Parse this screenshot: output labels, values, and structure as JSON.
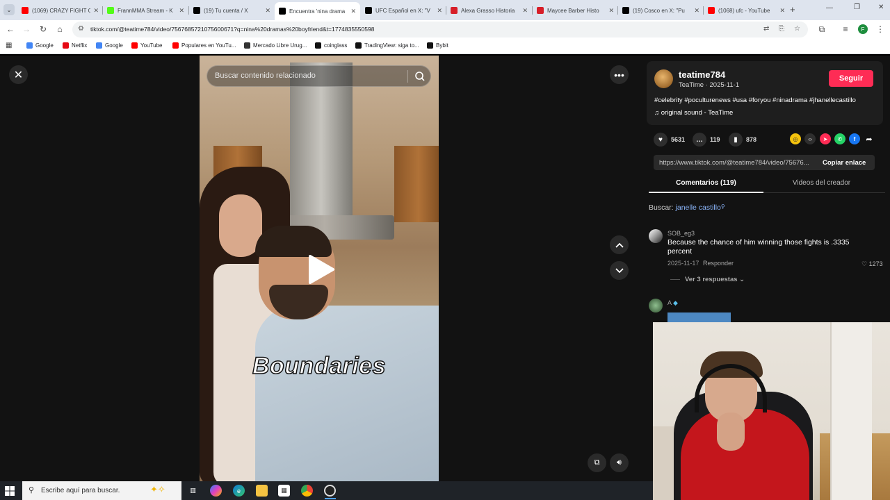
{
  "tabs": [
    {
      "label": "(1069) CRAZY FIGHT C",
      "icon": "youtube-icon",
      "color": "#ff0000"
    },
    {
      "label": "FrannMMA Stream - K",
      "icon": "kick-icon",
      "color": "#53fc18"
    },
    {
      "label": "(19) Tu cuenta / X",
      "icon": "x-icon",
      "color": "#000000"
    },
    {
      "label": "Encuentra 'nina drama",
      "icon": "tiktok-icon",
      "color": "#000000",
      "active": true
    },
    {
      "label": "UFC Español en X: \"V",
      "icon": "x-icon",
      "color": "#000000"
    },
    {
      "label": "Alexa Grasso Historia",
      "icon": "red-icon",
      "color": "#d71e28"
    },
    {
      "label": "Maycee Barber Histo",
      "icon": "red-icon",
      "color": "#d71e28"
    },
    {
      "label": "(19) Cosco en X: \"Pu",
      "icon": "x-icon",
      "color": "#000000"
    },
    {
      "label": "(1068) ufc - YouTube",
      "icon": "youtube-icon",
      "color": "#ff0000"
    }
  ],
  "browser": {
    "url": "tiktok.com/@teatime784/video/7567685721075600671?q=nina%20dramas%20boyfriend&t=1774835550598"
  },
  "bookmarks": [
    {
      "label": "Google",
      "icon": "google-icon",
      "color": "#4285f4"
    },
    {
      "label": "Netflix",
      "icon": "netflix-icon",
      "color": "#e50914"
    },
    {
      "label": "Google",
      "icon": "google-icon",
      "color": "#4285f4"
    },
    {
      "label": "YouTube",
      "icon": "youtube-icon",
      "color": "#ff0000"
    },
    {
      "label": "Populares en YouTu...",
      "icon": "youtube-icon",
      "color": "#ff0000"
    },
    {
      "label": "Mercado Libre Urug...",
      "icon": "mercadolibre-icon",
      "color": "#333333"
    },
    {
      "label": "coinglass",
      "icon": "coinglass-icon",
      "color": "#111111"
    },
    {
      "label": "TradingView: siga to...",
      "icon": "tradingview-icon",
      "color": "#111111"
    },
    {
      "label": "Bybit",
      "icon": "bybit-icon",
      "color": "#111111"
    }
  ],
  "video": {
    "search_placeholder": "Buscar contenido relacionado",
    "caption": "Boundaries"
  },
  "post": {
    "username": "teatime784",
    "subline": "TeaTime · 2025-11-1",
    "follow": "Seguir",
    "hashtags": "#celebrity #poculturenews #usa #foryou #ninadrama #jhanellecastillo",
    "sound": "original sound - TeaTime",
    "likes": "5631",
    "comments": "119",
    "saves": "878",
    "link": "https://www.tiktok.com/@teatime784/video/75676...",
    "copy": "Copiar enlace"
  },
  "panel_tabs": {
    "comments": "Comentarios (119)",
    "videos": "Videos del creador"
  },
  "search": {
    "prefix": "Buscar:",
    "term": "janelle castillo"
  },
  "comment_list": [
    {
      "user": "SOB_eg3",
      "text": "Because the chance of him winning those fights is .3335 percent",
      "date": "2025-11-17",
      "reply": "Responder",
      "likes": "1273",
      "more": "Ver 3 respuestas"
    },
    {
      "user": "A"
    }
  ],
  "taskbar": {
    "search_placeholder": "Escribe aquí para buscar."
  }
}
